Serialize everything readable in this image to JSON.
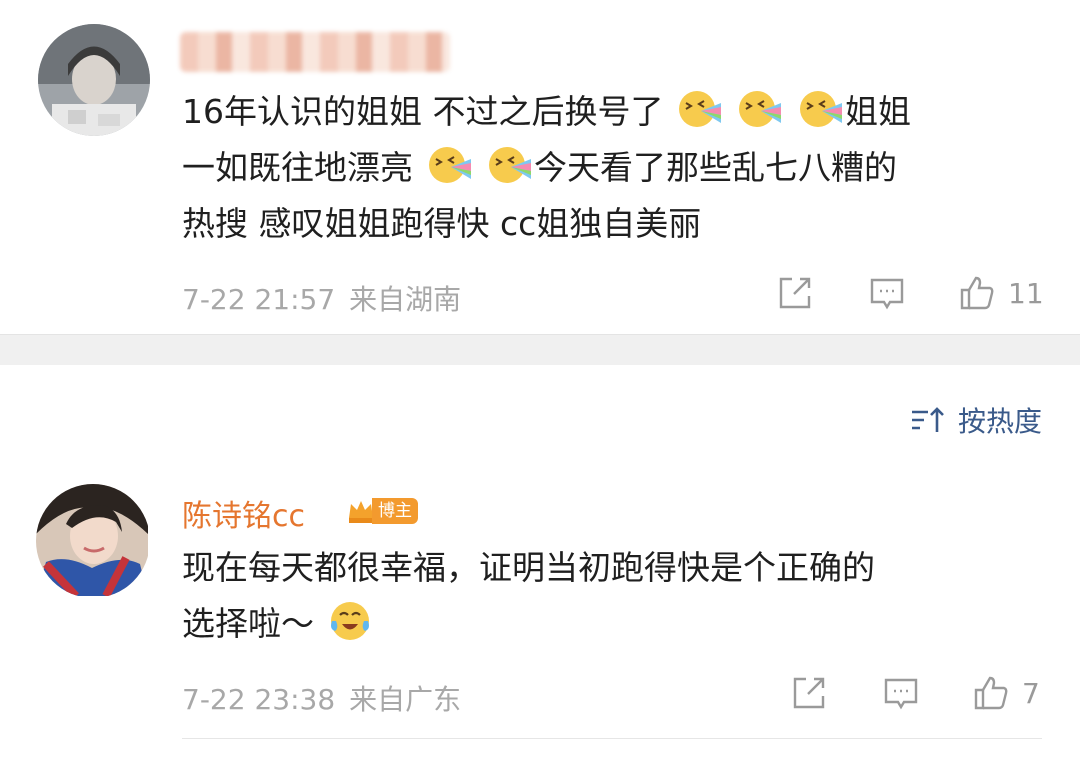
{
  "comment1": {
    "text_parts": [
      "16年认识的姐姐 不过之后换号了",
      "姐姐",
      "一如既往地漂亮",
      "今天看了那些乱七八糟的",
      "热搜 感叹姐姐跑得快 cc姐独自美丽"
    ],
    "time": "7-22 21:57",
    "location": "来自湖南",
    "likes": "11"
  },
  "sort": {
    "label": "按热度"
  },
  "comment2": {
    "username": "陈诗铭cc",
    "badge": "博主",
    "text_parts": [
      "现在每天都很幸福，证明当初跑得快是个正确的",
      "选择啦～"
    ],
    "time": "7-22 23:38",
    "location": "来自广东",
    "likes": "7"
  },
  "icons": {
    "share": "share-icon",
    "comment": "comment-icon",
    "like": "thumbs-up-icon",
    "sort": "sort-icon",
    "emoji_rainbow": "rainbow-vomit-emoji",
    "emoji_happy_tears": "tears-of-joy-emoji"
  }
}
